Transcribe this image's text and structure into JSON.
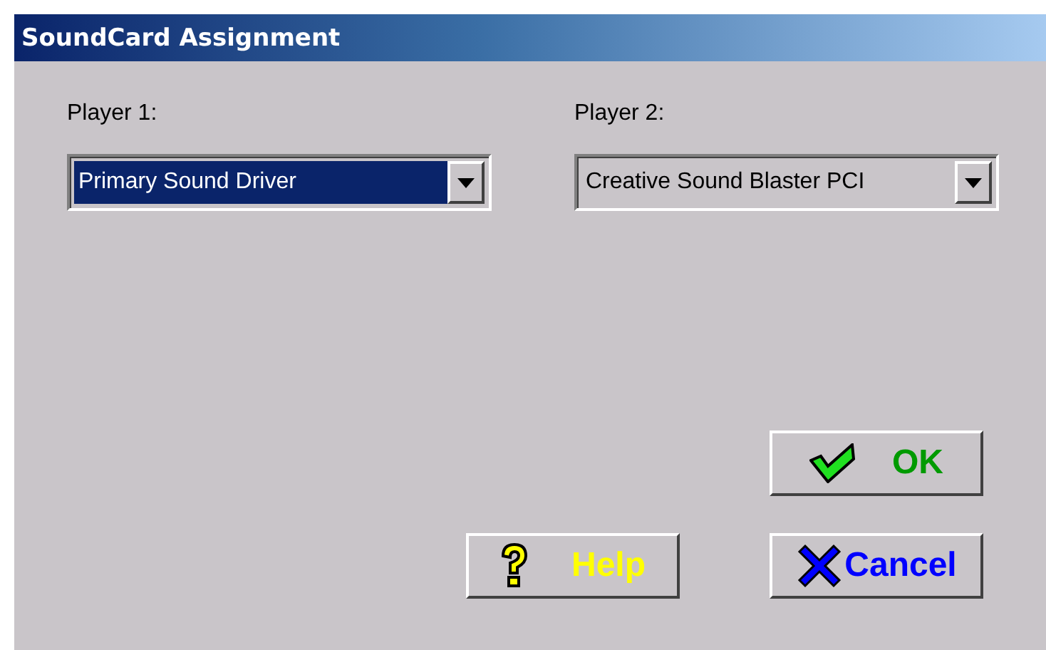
{
  "window": {
    "title": "SoundCard Assignment"
  },
  "players": [
    {
      "label": "Player 1:",
      "value": "Primary Sound Driver",
      "focused": true
    },
    {
      "label": "Player 2:",
      "value": "Creative Sound Blaster PCI",
      "focused": false
    }
  ],
  "buttons": [
    {
      "kind": "ok",
      "label": "OK",
      "color": "#009a00"
    },
    {
      "kind": "help",
      "label": "Help",
      "color": "#ffff00"
    },
    {
      "kind": "cancel",
      "label": "Cancel",
      "color": "#0000ff"
    }
  ]
}
